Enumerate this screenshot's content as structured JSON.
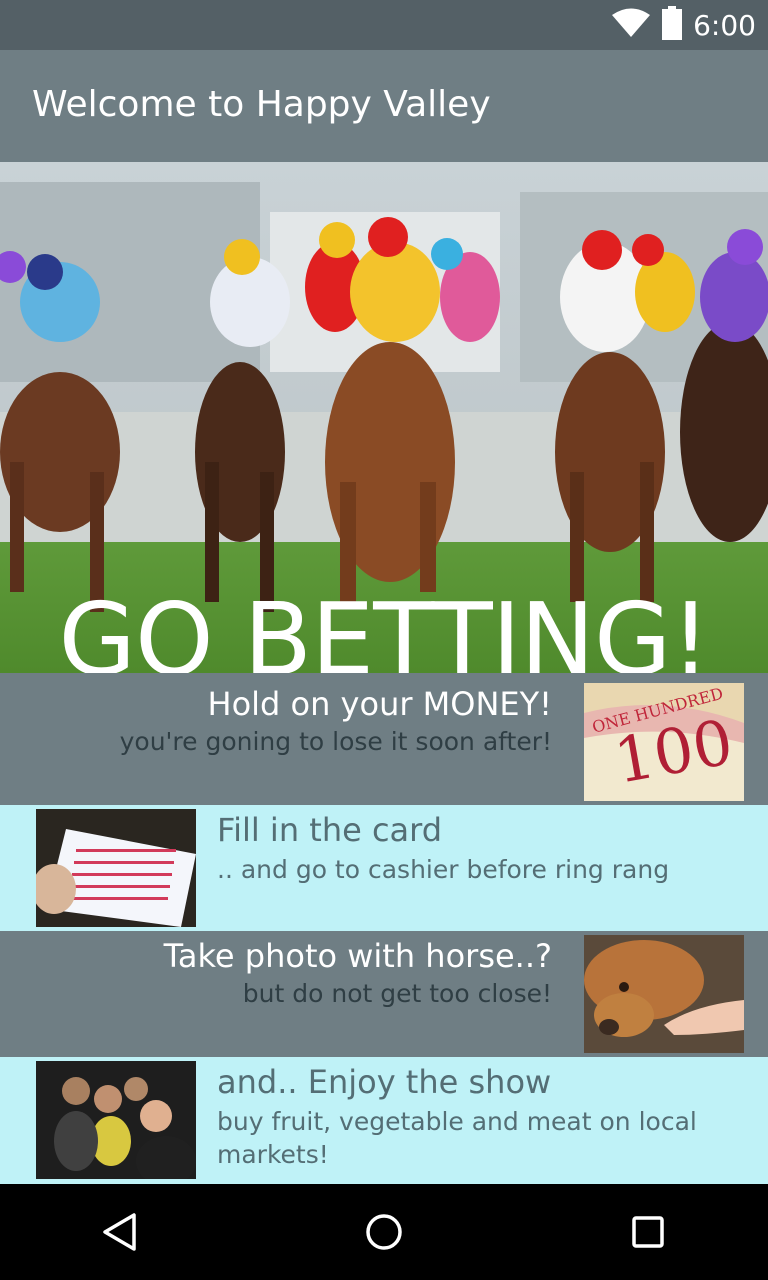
{
  "status_bar": {
    "time": "6:00",
    "icons": [
      "wifi-icon",
      "battery-icon"
    ]
  },
  "app_bar": {
    "title": "Welcome to Happy Valley"
  },
  "hero": {
    "image": "horse-racing-photo",
    "headline": "GO BETTING!"
  },
  "items": [
    {
      "title": "Hold on your MONEY!",
      "subtitle": "you're goning to lose it soon after!",
      "image": "banknote-100-photo"
    },
    {
      "title": "Fill in the card",
      "subtitle": ".. and go to cashier before ring rang",
      "image": "betting-slip-photo"
    },
    {
      "title": "Take photo with horse..?",
      "subtitle": "but do not get too close!",
      "image": "deer-hand-photo"
    },
    {
      "title": "and.. Enjoy the show",
      "subtitle": "buy fruit, vegetable and meat on local markets!",
      "image": "cheering-crowd-photo"
    }
  ],
  "nav_bar": {
    "icons": [
      "back-icon",
      "home-icon",
      "recents-icon"
    ]
  },
  "colors": {
    "status_bar": "#546066",
    "app_bar": "#6f7e84",
    "row_dark": "#6f7e84",
    "row_light": "#bff2f7",
    "nav_bar": "#000000"
  }
}
